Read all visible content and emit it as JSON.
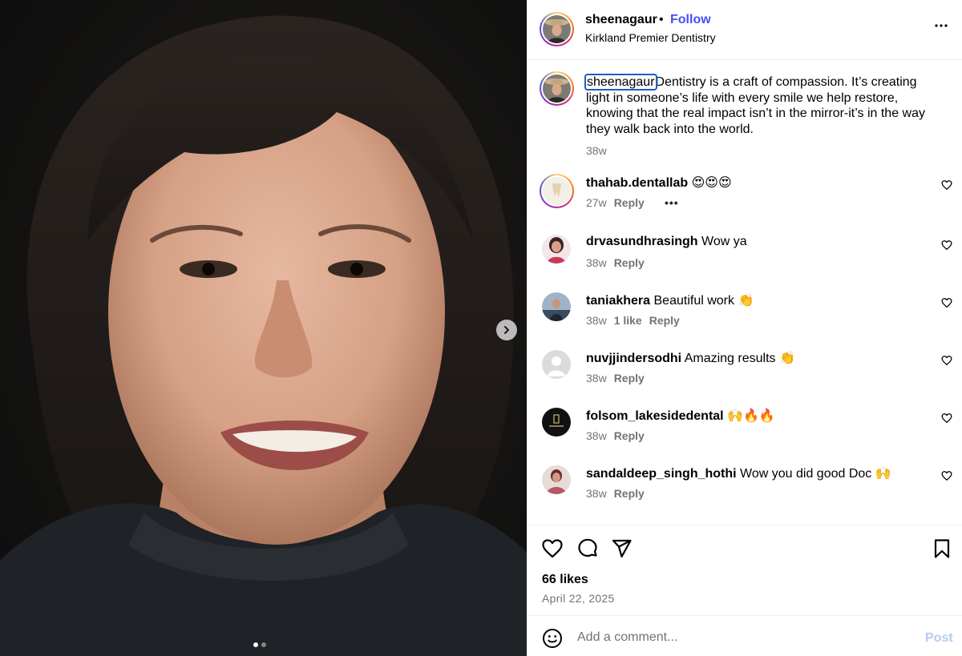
{
  "header": {
    "username": "sheenagaur",
    "separator": "•",
    "follow_label": "Follow",
    "location": "Kirkland Premier Dentistry",
    "more_icon": "more-horizontal-icon"
  },
  "media": {
    "slide_count": 2,
    "active_slide": 1,
    "next_icon": "chevron-right-icon"
  },
  "caption": {
    "username": "sheenagaur",
    "text": "Dentistry is a craft of compassion. It’s creating light in someone’s life with every smile we help restore, knowing that the real impact isn’t in the mirror-it’s in the way they walk back into the world.",
    "time": "38w"
  },
  "comments": [
    {
      "username": "thahab.dentallab",
      "text": "😍😍😍",
      "time": "27w",
      "likes": "",
      "reply": "Reply",
      "more": "•••",
      "avatar_color": "#efe9df"
    },
    {
      "username": "drvasundhrasingh",
      "text": "Wow ya",
      "time": "38w",
      "likes": "",
      "reply": "Reply",
      "more": "",
      "avatar_color": "#c93a55"
    },
    {
      "username": "taniakhera",
      "text": "Beautiful work 👏",
      "time": "38w",
      "likes": "1 like",
      "reply": "Reply",
      "more": "",
      "avatar_color": "#3b4a5c"
    },
    {
      "username": "nuvjjindersodhi",
      "text": "Amazing results 👏",
      "time": "38w",
      "likes": "",
      "reply": "Reply",
      "more": "",
      "avatar_color": "#dbdbdb"
    },
    {
      "username": "folsom_lakesidedental",
      "text": "🙌🔥🔥",
      "time": "38w",
      "likes": "",
      "reply": "Reply",
      "more": "",
      "avatar_color": "#111111"
    },
    {
      "username": "sandaldeep_singh_hothi",
      "text": "Wow you did good Doc 🙌",
      "time": "38w",
      "likes": "",
      "reply": "Reply",
      "more": "",
      "avatar_color": "#b85566"
    }
  ],
  "actions": {
    "like_icon": "heart-icon",
    "comment_icon": "comment-icon",
    "share_icon": "share-icon",
    "save_icon": "bookmark-icon",
    "likes": "66 likes",
    "date": "April 22, 2025"
  },
  "add_comment": {
    "emoji_icon": "emoji-icon",
    "placeholder": "Add a comment...",
    "post_label": "Post"
  }
}
